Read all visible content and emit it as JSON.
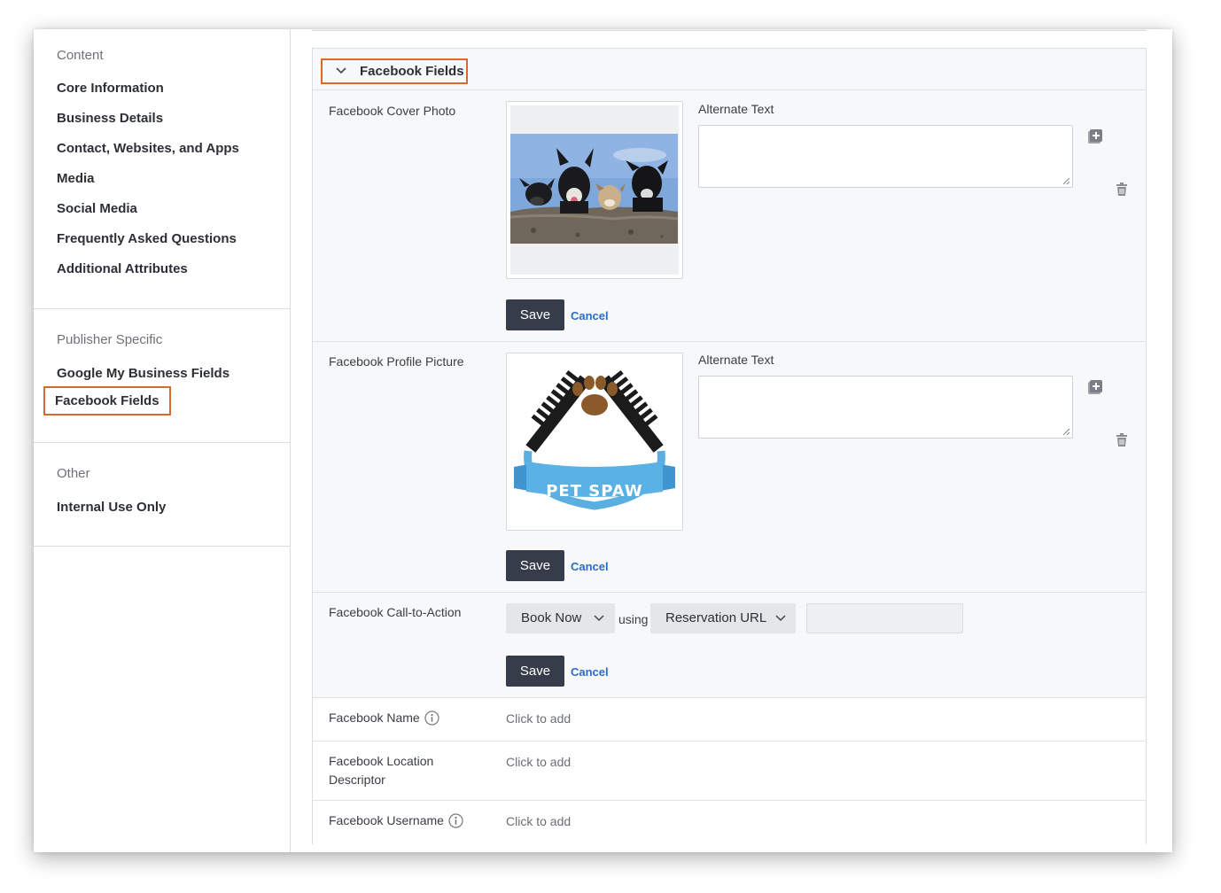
{
  "sidebar": {
    "content_heading": "Content",
    "content_items": [
      {
        "label": "Core Information"
      },
      {
        "label": "Business Details"
      },
      {
        "label": "Contact, Websites, and Apps"
      },
      {
        "label": "Media"
      },
      {
        "label": "Social Media"
      },
      {
        "label": "Frequently Asked Questions"
      },
      {
        "label": "Additional Attributes"
      }
    ],
    "publisher_heading": "Publisher Specific",
    "publisher_items": [
      {
        "label": "Google My Business Fields"
      },
      {
        "label": "Facebook Fields"
      }
    ],
    "other_heading": "Other",
    "other_items": [
      {
        "label": "Internal Use Only"
      }
    ]
  },
  "section": {
    "title": "Facebook Fields",
    "cover_photo": {
      "label": "Facebook Cover Photo",
      "alt_label": "Alternate Text",
      "alt_value": "",
      "save": "Save",
      "cancel": "Cancel"
    },
    "profile_picture": {
      "label": "Facebook Profile Picture",
      "alt_label": "Alternate Text",
      "alt_value": "",
      "logo_text": "PET SPAW",
      "save": "Save",
      "cancel": "Cancel"
    },
    "call_to_action": {
      "label": "Facebook Call-to-Action",
      "action_value": "Book Now",
      "using": "using",
      "url_type_value": "Reservation URL",
      "url_value": "",
      "save": "Save",
      "cancel": "Cancel"
    },
    "name": {
      "label": "Facebook Name",
      "value": "Click to add"
    },
    "location_descriptor": {
      "label_line1": "Facebook Location",
      "label_line2": "Descriptor",
      "value": "Click to add"
    },
    "username": {
      "label": "Facebook Username",
      "value": "Click to add"
    }
  },
  "colors": {
    "highlight": "#d9692e",
    "save_button": "#363c4a",
    "cancel_link": "#2b6cc4",
    "section_bg": "#f7f8fa"
  }
}
